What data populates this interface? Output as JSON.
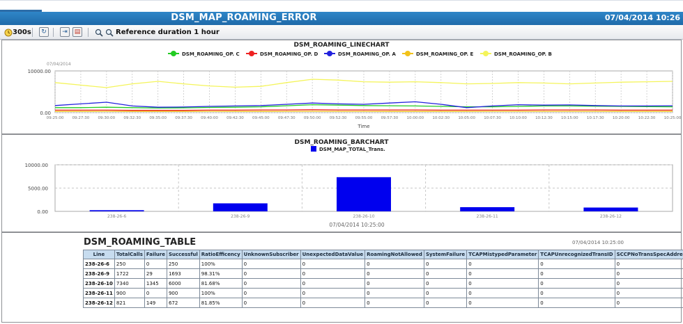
{
  "window": {
    "title": "DSM_MAP_ROAMING_ERROR",
    "datetime": "07/04/2014 10:26"
  },
  "toolbar": {
    "refresh_label": "300s",
    "reference_label": "Reference duration 1 hour"
  },
  "colors": {
    "title_bar": "#2577ba",
    "bar": "#0000ee",
    "op_c": "#22cc22",
    "op_d": "#ee2222",
    "op_a": "#2222dd",
    "op_e": "#f2c21a",
    "op_b": "#f4f45a"
  },
  "chart_data": [
    {
      "type": "line",
      "title": "DSM_ROAMING_LINECHART",
      "subtitle": "07/04/2014",
      "xlabel": "Time",
      "ylabel": "",
      "ylim": [
        0,
        10000
      ],
      "yticks": [
        "10000.00",
        "0.00"
      ],
      "grid": true,
      "legend": "top",
      "x": [
        "09:25:00",
        "09:27:30",
        "09:30:00",
        "09:32:30",
        "09:35:00",
        "09:37:30",
        "09:40:00",
        "09:42:30",
        "09:45:00",
        "09:47:30",
        "09:50:00",
        "09:52:30",
        "09:55:00",
        "09:57:30",
        "10:00:00",
        "10:02:30",
        "10:05:00",
        "10:07:30",
        "10:10:00",
        "10:12:30",
        "10:15:00",
        "10:17:30",
        "10:20:00",
        "10:22:30",
        "10:25:00"
      ],
      "series": [
        {
          "name": "DSM_ROAMING_OP. C",
          "values": [
            1200,
            1200,
            1300,
            1200,
            1100,
            1150,
            1250,
            1300,
            1400,
            1650,
            1900,
            1800,
            1700,
            1650,
            1600,
            1500,
            1400,
            1400,
            1500,
            1600,
            1600,
            1550,
            1500,
            1450,
            1400
          ]
        },
        {
          "name": "DSM_ROAMING_OP. D",
          "values": [
            600,
            600,
            600,
            550,
            550,
            550,
            600,
            600,
            650,
            650,
            700,
            650,
            650,
            650,
            650,
            600,
            600,
            600,
            600,
            650,
            650,
            650,
            600,
            600,
            600
          ]
        },
        {
          "name": "DSM_ROAMING_OP. A",
          "values": [
            1700,
            2100,
            2500,
            1600,
            1300,
            1350,
            1500,
            1600,
            1700,
            2000,
            2300,
            2100,
            2000,
            2300,
            2600,
            2000,
            1200,
            1600,
            1900,
            1800,
            1850,
            1700,
            1600,
            1600,
            1650
          ]
        },
        {
          "name": "DSM_ROAMING_OP. E",
          "values": [
            300,
            300,
            320,
            300,
            300,
            300,
            310,
            300,
            300,
            320,
            330,
            320,
            310,
            300,
            300,
            300,
            300,
            310,
            320,
            320,
            320,
            310,
            300,
            300,
            300
          ]
        },
        {
          "name": "DSM_ROAMING_OP. B",
          "values": [
            7200,
            6600,
            6000,
            6900,
            7500,
            6900,
            6400,
            6100,
            6300,
            7200,
            8000,
            7800,
            7400,
            7300,
            7400,
            7200,
            6900,
            7000,
            7200,
            7100,
            6900,
            7100,
            7300,
            7400,
            7500
          ]
        }
      ]
    },
    {
      "type": "bar",
      "title": "DSM_ROAMING_BARCHART",
      "xlabel": "07/04/2014 10:25:00",
      "ylabel": "",
      "ylim": [
        0,
        10000
      ],
      "yticks": [
        "10000.00",
        "5000.00",
        "0.00"
      ],
      "grid": true,
      "legend": "top",
      "categories": [
        "238-26-6",
        "238-26-9",
        "238-26-10",
        "238-26-11",
        "238-26-12"
      ],
      "series": [
        {
          "name": "DSM_MAP_TOTAL_Trans.",
          "values": [
            250,
            1722,
            7340,
            900,
            821
          ]
        }
      ]
    },
    {
      "type": "table",
      "title": "DSM_ROAMING_TABLE",
      "date": "07/04/2014 10:25:00",
      "columns": [
        "Line",
        "TotalCalls",
        "Failure",
        "Successful",
        "RatioEfficency",
        "UnknownSubscriber",
        "UnexpectedDataValue",
        "RoamingNotAllowed",
        "SystemFailure",
        "TCAPMistypedParameter",
        "TCAPUnrecognizedTransID",
        "SCCPNoTransSpecAddress"
      ],
      "rows": [
        [
          "238-26-6",
          "250",
          "0",
          "250",
          "100%",
          "0",
          "0",
          "0",
          "0",
          "0",
          "0",
          "0"
        ],
        [
          "238-26-9",
          "1722",
          "29",
          "1693",
          "98.31%",
          "0",
          "0",
          "0",
          "0",
          "0",
          "0",
          "0"
        ],
        [
          "238-26-10",
          "7340",
          "1345",
          "6000",
          "81.68%",
          "0",
          "0",
          "0",
          "0",
          "0",
          "0",
          "0"
        ],
        [
          "238-26-11",
          "900",
          "0",
          "900",
          "100%",
          "0",
          "0",
          "0",
          "0",
          "0",
          "0",
          "0"
        ],
        [
          "238-26-12",
          "821",
          "149",
          "672",
          "81.85%",
          "0",
          "0",
          "0",
          "0",
          "0",
          "0",
          "0"
        ]
      ]
    }
  ]
}
